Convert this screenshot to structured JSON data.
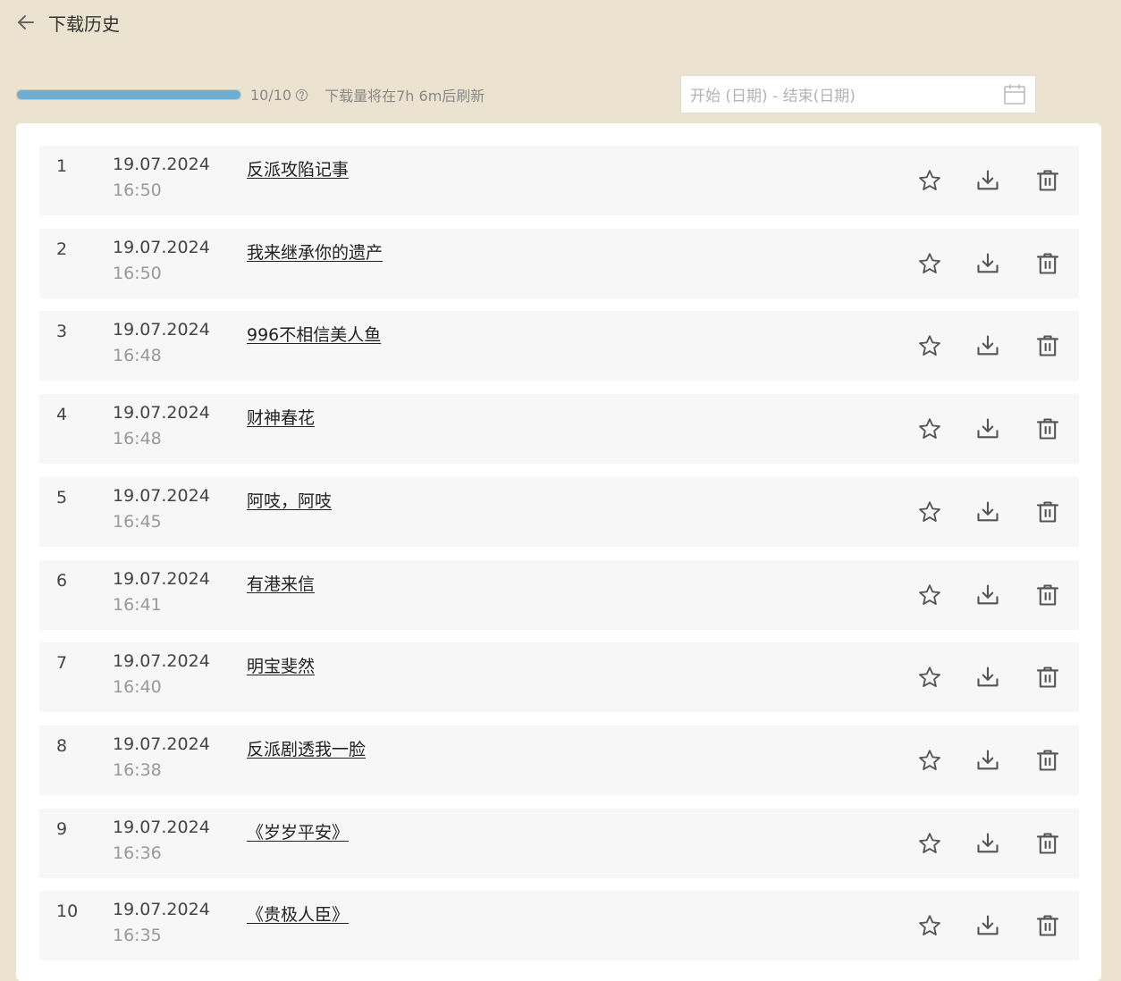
{
  "header": {
    "title": "下载历史",
    "back_icon": "arrow-left-icon"
  },
  "quota": {
    "progress_percent": 100,
    "progress_color": "#6aaed6",
    "count_text": "10/10",
    "refresh_text": "下载量将在7h 6m后刷新"
  },
  "date_filter": {
    "placeholder": "开始 (日期) - 结束(日期)"
  },
  "items": [
    {
      "num": "1",
      "date": "19.07.2024",
      "time": "16:50",
      "title": "反派攻陷记事"
    },
    {
      "num": "2",
      "date": "19.07.2024",
      "time": "16:50",
      "title": "我来继承你的遗产"
    },
    {
      "num": "3",
      "date": "19.07.2024",
      "time": "16:48",
      "title": "996不相信美人鱼"
    },
    {
      "num": "4",
      "date": "19.07.2024",
      "time": "16:48",
      "title": "财神春花"
    },
    {
      "num": "5",
      "date": "19.07.2024",
      "time": "16:45",
      "title": "阿吱，阿吱"
    },
    {
      "num": "6",
      "date": "19.07.2024",
      "time": "16:41",
      "title": "有港来信"
    },
    {
      "num": "7",
      "date": "19.07.2024",
      "time": "16:40",
      "title": "明宝斐然"
    },
    {
      "num": "8",
      "date": "19.07.2024",
      "time": "16:38",
      "title": "反派剧透我一脸"
    },
    {
      "num": "9",
      "date": "19.07.2024",
      "time": "16:36",
      "title": "《岁岁平安》"
    },
    {
      "num": "10",
      "date": "19.07.2024",
      "time": "16:35",
      "title": "《贵极人臣》"
    }
  ]
}
